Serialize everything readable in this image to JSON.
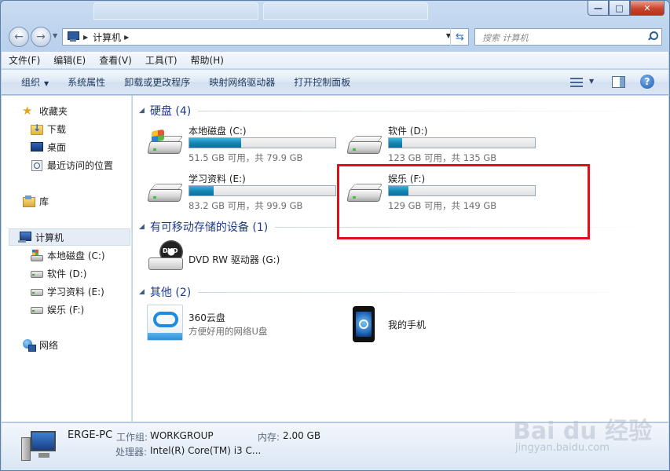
{
  "window": {
    "ghost_tabs": [
      "",
      ""
    ],
    "controls": {
      "minimize": "—",
      "maximize": "□",
      "close": "✕"
    }
  },
  "address": {
    "path": "计算机",
    "search_placeholder": "搜索 计算机"
  },
  "menu": [
    "文件(F)",
    "编辑(E)",
    "查看(V)",
    "工具(T)",
    "帮助(H)"
  ],
  "commands": {
    "organize": "组织",
    "items": [
      "系统属性",
      "卸载或更改程序",
      "映射网络驱动器",
      "打开控制面板"
    ]
  },
  "nav": {
    "favorites": "收藏夹",
    "downloads": "下载",
    "desktop": "桌面",
    "recent": "最近访问的位置",
    "libraries": "库",
    "computer": "计算机",
    "drives": [
      "本地磁盘 (C:)",
      "软件 (D:)",
      "学习资料 (E:)",
      "娱乐 (F:)"
    ],
    "network": "网络"
  },
  "groups": {
    "hdd": "硬盘 (4)",
    "removable": "有可移动存储的设备 (1)",
    "other": "其他 (2)"
  },
  "drives": [
    {
      "name": "本地磁盘 (C:)",
      "info": "51.5 GB 可用，共 79.9 GB",
      "used_fraction": 0.355
    },
    {
      "name": "软件 (D:)",
      "info": "123 GB 可用，共 135 GB",
      "used_fraction": 0.089
    },
    {
      "name": "学习资料 (E:)",
      "info": "83.2 GB 可用，共 99.9 GB",
      "used_fraction": 0.167
    },
    {
      "name": "娱乐 (F:)",
      "info": "129 GB 可用，共 149 GB",
      "used_fraction": 0.134
    }
  ],
  "removable": {
    "name": "DVD RW 驱动器 (G:)",
    "icon_label": "DVD"
  },
  "other": [
    {
      "name": "360云盘",
      "sub": "方便好用的网络U盘"
    },
    {
      "name": "我的手机"
    }
  ],
  "details": {
    "pc_name": "ERGE-PC",
    "workgroup_label": "工作组:",
    "workgroup": "WORKGROUP",
    "memory_label": "内存:",
    "memory": "2.00 GB",
    "cpu_label": "处理器:",
    "cpu": "Intel(R) Core(TM) i3 C..."
  },
  "watermark": {
    "main": "Bai du 经验",
    "sub": "jingyan.baidu.com"
  },
  "colors": {
    "bar_fill": "#1587b6",
    "highlight": "#e0101a",
    "group_title": "#1e3a8a"
  }
}
